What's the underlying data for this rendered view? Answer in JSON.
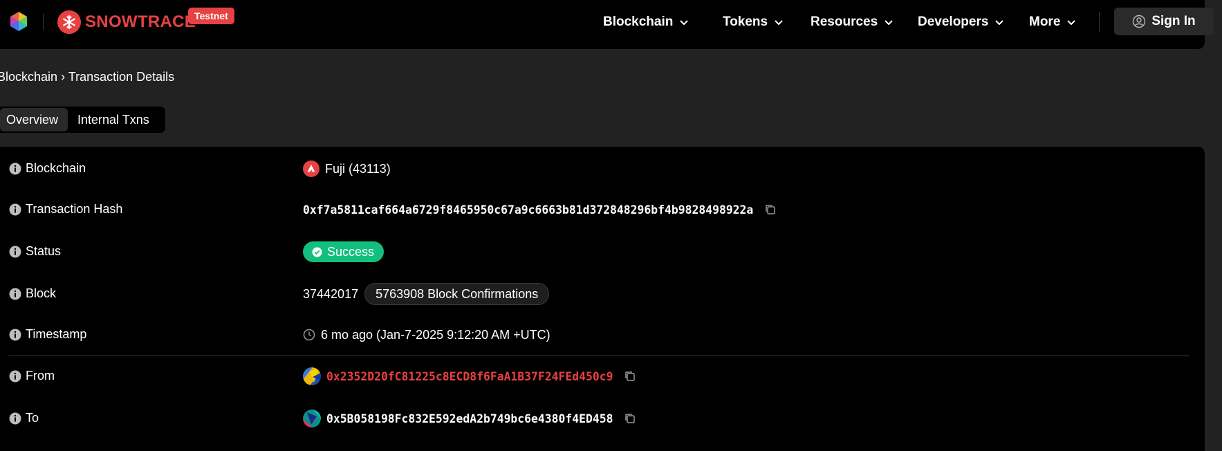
{
  "brand": {
    "name": "SNOWTRACE",
    "badge": "Testnet"
  },
  "nav": {
    "items": [
      {
        "label": "Blockchain"
      },
      {
        "label": "Tokens"
      },
      {
        "label": "Resources"
      },
      {
        "label": "Developers"
      },
      {
        "label": "More"
      }
    ],
    "sign_in_label": "Sign In"
  },
  "breadcrumb": {
    "parent": "Blockchain",
    "separator": "›",
    "current": "Transaction Details"
  },
  "tabs": [
    {
      "label": "Overview",
      "active": true
    },
    {
      "label": "Internal Txns",
      "active": false
    }
  ],
  "details": {
    "blockchain": {
      "label": "Blockchain",
      "value": "Fuji (43113)"
    },
    "tx_hash": {
      "label": "Transaction Hash",
      "value": "0xf7a5811caf664a6729f8465950c67a9c6663b81d372848296bf4b9828498922a"
    },
    "status": {
      "label": "Status",
      "value": "Success"
    },
    "block": {
      "label": "Block",
      "number": "37442017",
      "confirmations": "5763908 Block Confirmations"
    },
    "timestamp": {
      "label": "Timestamp",
      "value": "6 mo ago (Jan-7-2025 9:12:20 AM +UTC)"
    },
    "from": {
      "label": "From",
      "value": "0x2352D20fC81225c8ECD8f6FaA1B37F24FEd450c9"
    },
    "to": {
      "label": "To",
      "value": "0x5B058198Fc832E592edA2b749bc6e4380f4ED458"
    }
  },
  "colors": {
    "brand": "#e84142",
    "success": "#13bf7e",
    "background": "#222222",
    "panel": "#000000"
  },
  "icons": [
    "app-cube-icon",
    "snowtrace-logo-icon",
    "chevron-down-icon",
    "user-icon",
    "info-icon",
    "avalanche-icon",
    "copy-icon",
    "check-circle-icon",
    "clock-icon"
  ]
}
